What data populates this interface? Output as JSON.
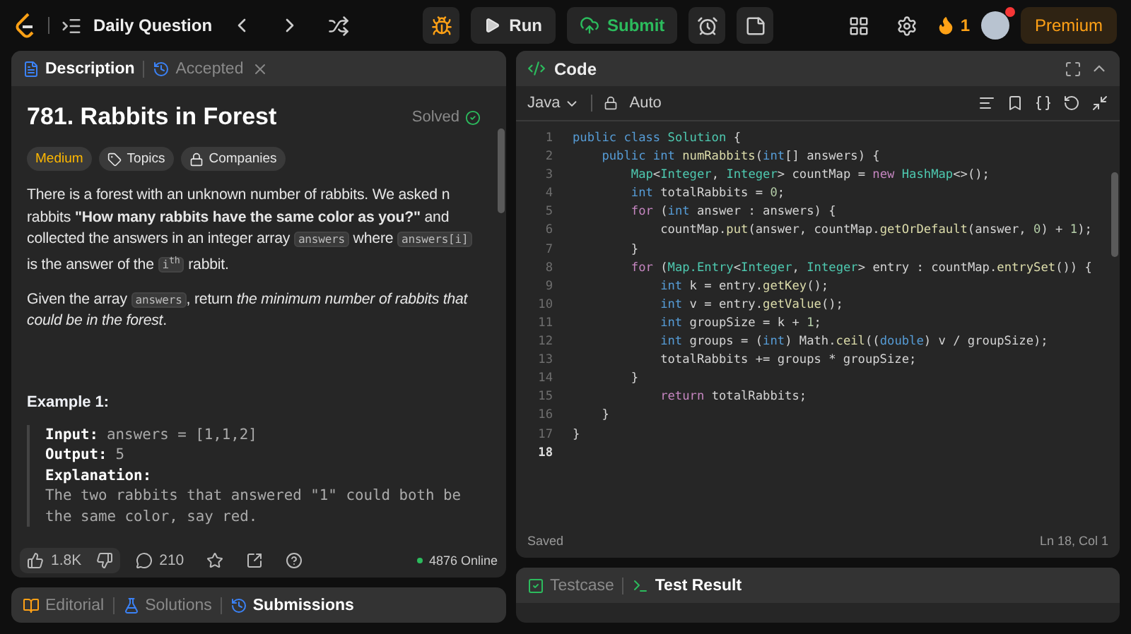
{
  "topbar": {
    "title": "Daily Question",
    "run": "Run",
    "submit": "Submit",
    "streak": "1",
    "premium": "Premium",
    "notification": true
  },
  "left_tabs": [
    {
      "label": "Description",
      "selected": true
    },
    {
      "label": "Accepted",
      "selected": false
    }
  ],
  "problem": {
    "title": "781. Rabbits in Forest",
    "status": "Solved",
    "difficulty": "Medium",
    "tags": [
      "Topics",
      "Companies"
    ],
    "paragraphs": [
      [
        {
          "kind": "text",
          "t": "There is a forest with an unknown number of rabbits. We asked n rabbits **\"How many rabbits have the same color as you?\"** and collected the answers in an integer array "
        },
        {
          "kind": "code",
          "t": "answers"
        },
        {
          "kind": "text",
          "t": " where "
        },
        {
          "kind": "code",
          "t": "answers[i]"
        },
        {
          "kind": "text",
          "t": " is the answer of the "
        },
        {
          "kind": "code",
          "t": "i$^{th}$"
        },
        {
          "kind": "text",
          "t": " rabbit."
        }
      ],
      [
        {
          "kind": "text",
          "t": "Given the array "
        },
        {
          "kind": "code",
          "t": "answers"
        },
        {
          "kind": "text",
          "t": ", return *the minimum number of rabbits that could be in the forest*."
        }
      ]
    ],
    "example_title": "Example 1:",
    "example": [
      {
        "label": "Input:",
        "value": "answers = [1,1,2]"
      },
      {
        "label": "Output:",
        "value": "5"
      },
      {
        "label": "Explanation:"
      }
    ],
    "explanation": "The two rabbits that answered \"1\" could both be the same color, say red."
  },
  "footer": {
    "likes": "1.8K",
    "comments": "210",
    "online": "4876 Online"
  },
  "bottom_tabs": [
    {
      "label": "Editorial",
      "selected": false
    },
    {
      "label": "Solutions",
      "selected": false
    },
    {
      "label": "Submissions",
      "selected": true
    }
  ],
  "code_panel": {
    "title": "Code",
    "language": "Java",
    "mode": "Auto",
    "status": "Saved",
    "position": "Ln 18, Col 1",
    "lines": [
      {
        "number": "1",
        "current": false,
        "tokens": [
          {
            "kind": "keyword",
            "t": "public class "
          },
          {
            "kind": "type",
            "t": "Solution"
          },
          {
            "kind": "plain",
            "t": " {"
          }
        ]
      },
      {
        "number": "2",
        "current": false,
        "tokens": [
          {
            "kind": "keyword",
            "t": "    public int "
          },
          {
            "kind": "function",
            "t": "numRabbits"
          },
          {
            "kind": "plain",
            "t": "("
          },
          {
            "kind": "keyword",
            "t": "int"
          },
          {
            "kind": "plain",
            "t": "[] answers) {"
          }
        ]
      },
      {
        "number": "3",
        "current": false,
        "tokens": [
          {
            "kind": "type",
            "t": "        Map"
          },
          {
            "kind": "plain",
            "t": "<"
          },
          {
            "kind": "type",
            "t": "Integer"
          },
          {
            "kind": "plain",
            "t": ", "
          },
          {
            "kind": "type",
            "t": "Integer"
          },
          {
            "kind": "plain",
            "t": "> countMap = "
          },
          {
            "kind": "control",
            "t": "new "
          },
          {
            "kind": "type",
            "t": "HashMap"
          },
          {
            "kind": "plain",
            "t": "<>();"
          }
        ]
      },
      {
        "number": "4",
        "current": false,
        "tokens": [
          {
            "kind": "keyword",
            "t": "        int"
          },
          {
            "kind": "plain",
            "t": " totalRabbits = "
          },
          {
            "kind": "number",
            "t": "0"
          },
          {
            "kind": "plain",
            "t": ";"
          }
        ]
      },
      {
        "number": "5",
        "current": false,
        "tokens": [
          {
            "kind": "control",
            "t": "        for"
          },
          {
            "kind": "plain",
            "t": " ("
          },
          {
            "kind": "keyword",
            "t": "int"
          },
          {
            "kind": "plain",
            "t": " answer : answers) {"
          }
        ]
      },
      {
        "number": "6",
        "current": false,
        "tokens": [
          {
            "kind": "plain",
            "t": "            countMap."
          },
          {
            "kind": "function",
            "t": "put"
          },
          {
            "kind": "plain",
            "t": "(answer, countMap."
          },
          {
            "kind": "function",
            "t": "getOrDefault"
          },
          {
            "kind": "plain",
            "t": "(answer, "
          },
          {
            "kind": "number",
            "t": "0"
          },
          {
            "kind": "plain",
            "t": ") + "
          },
          {
            "kind": "number",
            "t": "1"
          },
          {
            "kind": "plain",
            "t": ");"
          }
        ]
      },
      {
        "number": "7",
        "current": false,
        "tokens": [
          {
            "kind": "plain",
            "t": "        }"
          }
        ]
      },
      {
        "number": "8",
        "current": false,
        "tokens": [
          {
            "kind": "control",
            "t": "        for"
          },
          {
            "kind": "plain",
            "t": " ("
          },
          {
            "kind": "type",
            "t": "Map.Entry"
          },
          {
            "kind": "plain",
            "t": "<"
          },
          {
            "kind": "type",
            "t": "Integer"
          },
          {
            "kind": "plain",
            "t": ", "
          },
          {
            "kind": "type",
            "t": "Integer"
          },
          {
            "kind": "plain",
            "t": "> entry : countMap."
          },
          {
            "kind": "function",
            "t": "entrySet"
          },
          {
            "kind": "plain",
            "t": "()) {"
          }
        ]
      },
      {
        "number": "9",
        "current": false,
        "tokens": [
          {
            "kind": "keyword",
            "t": "            int"
          },
          {
            "kind": "plain",
            "t": " k = entry."
          },
          {
            "kind": "function",
            "t": "getKey"
          },
          {
            "kind": "plain",
            "t": "();"
          }
        ]
      },
      {
        "number": "10",
        "current": false,
        "tokens": [
          {
            "kind": "keyword",
            "t": "            int"
          },
          {
            "kind": "plain",
            "t": " v = entry."
          },
          {
            "kind": "function",
            "t": "getValue"
          },
          {
            "kind": "plain",
            "t": "();"
          }
        ]
      },
      {
        "number": "11",
        "current": false,
        "tokens": [
          {
            "kind": "keyword",
            "t": "            int"
          },
          {
            "kind": "plain",
            "t": " groupSize = k + "
          },
          {
            "kind": "number",
            "t": "1"
          },
          {
            "kind": "plain",
            "t": ";"
          }
        ]
      },
      {
        "number": "12",
        "current": false,
        "tokens": [
          {
            "kind": "keyword",
            "t": "            int"
          },
          {
            "kind": "plain",
            "t": " groups = ("
          },
          {
            "kind": "keyword",
            "t": "int"
          },
          {
            "kind": "plain",
            "t": ") Math."
          },
          {
            "kind": "function",
            "t": "ceil"
          },
          {
            "kind": "plain",
            "t": "(("
          },
          {
            "kind": "keyword",
            "t": "double"
          },
          {
            "kind": "plain",
            "t": ") v / groupSize);"
          }
        ]
      },
      {
        "number": "13",
        "current": false,
        "tokens": [
          {
            "kind": "plain",
            "t": "            totalRabbits += groups * groupSize;"
          }
        ]
      },
      {
        "number": "14",
        "current": false,
        "tokens": [
          {
            "kind": "plain",
            "t": "        }"
          }
        ]
      },
      {
        "number": "15",
        "current": false,
        "tokens": [
          {
            "kind": "control",
            "t": "            return"
          },
          {
            "kind": "plain",
            "t": " totalRabbits;"
          }
        ]
      },
      {
        "number": "16",
        "current": false,
        "tokens": [
          {
            "kind": "plain",
            "t": "    }"
          }
        ]
      },
      {
        "number": "17",
        "current": false,
        "tokens": [
          {
            "kind": "plain",
            "t": "}"
          }
        ]
      },
      {
        "number": "18",
        "current": true
      }
    ]
  },
  "test_tabs": [
    {
      "label": "Testcase",
      "selected": false
    },
    {
      "label": "Test Result",
      "selected": true
    }
  ]
}
